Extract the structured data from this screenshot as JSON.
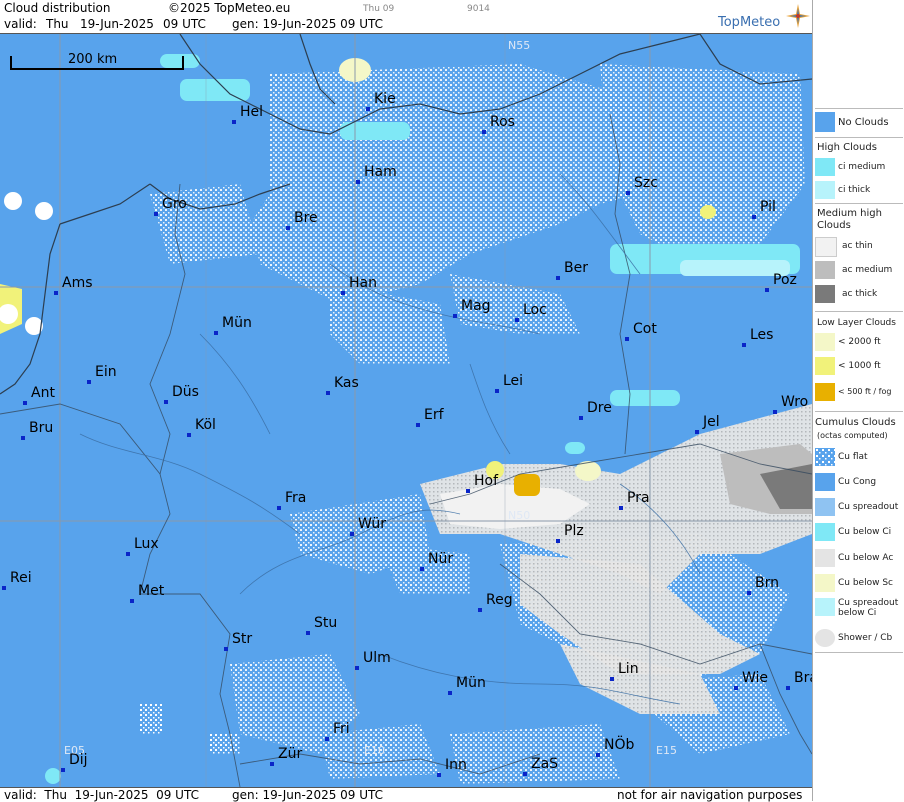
{
  "header": {
    "title": "Cloud distribution",
    "copyright": "©2025 TopMeteo.eu",
    "valid_label": "valid:",
    "valid_day": "Thu",
    "valid_date": "19-Jun-2025",
    "valid_time": "09 UTC",
    "gen_text": "gen: 19-Jun-2025 09 UTC",
    "small_day": "Thu 09",
    "small_code": "9014",
    "logo": "TopMeteo"
  },
  "footer": {
    "valid_text": "valid:  Thu  19-Jun-2025  09 UTC",
    "gen_text": "gen: 19-Jun-2025 09 UTC",
    "note": "not for air navigation purposes"
  },
  "map": {
    "scale_label": "200 km",
    "grid_labels": [
      "N55",
      "N50",
      "E05",
      "E10",
      "E15"
    ],
    "cities": [
      "Hel",
      "Kie",
      "Ros",
      "Szc",
      "Pil",
      "Gro",
      "Bre",
      "Ham",
      "Ams",
      "Han",
      "Ber",
      "Poz",
      "Mün",
      "Mag",
      "Loc",
      "Cot",
      "Les",
      "Ein",
      "Kas",
      "Lei",
      "Ant",
      "Düs",
      "Erf",
      "Dre",
      "Wro",
      "Bru",
      "Köl",
      "Jel",
      "Hof",
      "Pra",
      "Fra",
      "Wür",
      "Plz",
      "Lux",
      "Nür",
      "Rei",
      "Met",
      "Reg",
      "Brn",
      "Stu",
      "Str",
      "Ulm",
      "Lin",
      "Wie",
      "Bra",
      "Mün",
      "Fri",
      "Dij",
      "Zür",
      "Inn",
      "ZaS",
      "NÖb"
    ]
  },
  "legend": {
    "no_clouds": "No Clouds",
    "high_head": "High Clouds",
    "ci_medium": "ci medium",
    "ci_thick": "ci thick",
    "medium_head": "Medium high Clouds",
    "ac_thin": "ac thin",
    "ac_medium": "ac medium",
    "ac_thick": "ac thick",
    "low_head": "Low Layer Clouds",
    "low_2000": "< 2000 ft",
    "low_1000": "< 1000 ft",
    "low_500": "< 500 ft / fog",
    "cu_head": "Cumulus Clouds",
    "cu_sub": "(octas computed)",
    "cu_flat": "Cu flat",
    "cu_cong": "Cu Cong",
    "cu_spread": "Cu spreadout",
    "cu_below_ci": "Cu below Ci",
    "cu_below_ac": "Cu below Ac",
    "cu_below_sc": "Cu below Sc",
    "cu_spread_ci": "Cu spreadout below Ci",
    "shower": "Shower / Cb"
  },
  "colors": {
    "no_clouds": "#58a3ec",
    "ci_medium": "#7fe8f6",
    "ci_thick": "#b7f3fb",
    "ac_thin": "#f2f2f2",
    "ac_medium": "#bdbdbd",
    "ac_thick": "#7a7a7a",
    "low_2000": "#f4f7c8",
    "low_1000": "#f1f27a",
    "low_500": "#e8b000",
    "grid": "#8a98aa"
  }
}
